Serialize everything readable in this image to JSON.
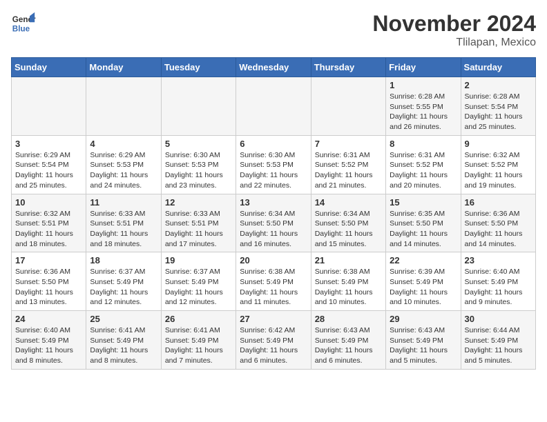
{
  "header": {
    "logo_line1": "General",
    "logo_line2": "Blue",
    "month": "November 2024",
    "location": "Tlilapan, Mexico"
  },
  "weekdays": [
    "Sunday",
    "Monday",
    "Tuesday",
    "Wednesday",
    "Thursday",
    "Friday",
    "Saturday"
  ],
  "weeks": [
    [
      {
        "day": "",
        "info": ""
      },
      {
        "day": "",
        "info": ""
      },
      {
        "day": "",
        "info": ""
      },
      {
        "day": "",
        "info": ""
      },
      {
        "day": "",
        "info": ""
      },
      {
        "day": "1",
        "info": "Sunrise: 6:28 AM\nSunset: 5:55 PM\nDaylight: 11 hours and 26 minutes."
      },
      {
        "day": "2",
        "info": "Sunrise: 6:28 AM\nSunset: 5:54 PM\nDaylight: 11 hours and 25 minutes."
      }
    ],
    [
      {
        "day": "3",
        "info": "Sunrise: 6:29 AM\nSunset: 5:54 PM\nDaylight: 11 hours and 25 minutes."
      },
      {
        "day": "4",
        "info": "Sunrise: 6:29 AM\nSunset: 5:53 PM\nDaylight: 11 hours and 24 minutes."
      },
      {
        "day": "5",
        "info": "Sunrise: 6:30 AM\nSunset: 5:53 PM\nDaylight: 11 hours and 23 minutes."
      },
      {
        "day": "6",
        "info": "Sunrise: 6:30 AM\nSunset: 5:53 PM\nDaylight: 11 hours and 22 minutes."
      },
      {
        "day": "7",
        "info": "Sunrise: 6:31 AM\nSunset: 5:52 PM\nDaylight: 11 hours and 21 minutes."
      },
      {
        "day": "8",
        "info": "Sunrise: 6:31 AM\nSunset: 5:52 PM\nDaylight: 11 hours and 20 minutes."
      },
      {
        "day": "9",
        "info": "Sunrise: 6:32 AM\nSunset: 5:52 PM\nDaylight: 11 hours and 19 minutes."
      }
    ],
    [
      {
        "day": "10",
        "info": "Sunrise: 6:32 AM\nSunset: 5:51 PM\nDaylight: 11 hours and 18 minutes."
      },
      {
        "day": "11",
        "info": "Sunrise: 6:33 AM\nSunset: 5:51 PM\nDaylight: 11 hours and 18 minutes."
      },
      {
        "day": "12",
        "info": "Sunrise: 6:33 AM\nSunset: 5:51 PM\nDaylight: 11 hours and 17 minutes."
      },
      {
        "day": "13",
        "info": "Sunrise: 6:34 AM\nSunset: 5:50 PM\nDaylight: 11 hours and 16 minutes."
      },
      {
        "day": "14",
        "info": "Sunrise: 6:34 AM\nSunset: 5:50 PM\nDaylight: 11 hours and 15 minutes."
      },
      {
        "day": "15",
        "info": "Sunrise: 6:35 AM\nSunset: 5:50 PM\nDaylight: 11 hours and 14 minutes."
      },
      {
        "day": "16",
        "info": "Sunrise: 6:36 AM\nSunset: 5:50 PM\nDaylight: 11 hours and 14 minutes."
      }
    ],
    [
      {
        "day": "17",
        "info": "Sunrise: 6:36 AM\nSunset: 5:50 PM\nDaylight: 11 hours and 13 minutes."
      },
      {
        "day": "18",
        "info": "Sunrise: 6:37 AM\nSunset: 5:49 PM\nDaylight: 11 hours and 12 minutes."
      },
      {
        "day": "19",
        "info": "Sunrise: 6:37 AM\nSunset: 5:49 PM\nDaylight: 11 hours and 12 minutes."
      },
      {
        "day": "20",
        "info": "Sunrise: 6:38 AM\nSunset: 5:49 PM\nDaylight: 11 hours and 11 minutes."
      },
      {
        "day": "21",
        "info": "Sunrise: 6:38 AM\nSunset: 5:49 PM\nDaylight: 11 hours and 10 minutes."
      },
      {
        "day": "22",
        "info": "Sunrise: 6:39 AM\nSunset: 5:49 PM\nDaylight: 11 hours and 10 minutes."
      },
      {
        "day": "23",
        "info": "Sunrise: 6:40 AM\nSunset: 5:49 PM\nDaylight: 11 hours and 9 minutes."
      }
    ],
    [
      {
        "day": "24",
        "info": "Sunrise: 6:40 AM\nSunset: 5:49 PM\nDaylight: 11 hours and 8 minutes."
      },
      {
        "day": "25",
        "info": "Sunrise: 6:41 AM\nSunset: 5:49 PM\nDaylight: 11 hours and 8 minutes."
      },
      {
        "day": "26",
        "info": "Sunrise: 6:41 AM\nSunset: 5:49 PM\nDaylight: 11 hours and 7 minutes."
      },
      {
        "day": "27",
        "info": "Sunrise: 6:42 AM\nSunset: 5:49 PM\nDaylight: 11 hours and 6 minutes."
      },
      {
        "day": "28",
        "info": "Sunrise: 6:43 AM\nSunset: 5:49 PM\nDaylight: 11 hours and 6 minutes."
      },
      {
        "day": "29",
        "info": "Sunrise: 6:43 AM\nSunset: 5:49 PM\nDaylight: 11 hours and 5 minutes."
      },
      {
        "day": "30",
        "info": "Sunrise: 6:44 AM\nSunset: 5:49 PM\nDaylight: 11 hours and 5 minutes."
      }
    ]
  ]
}
